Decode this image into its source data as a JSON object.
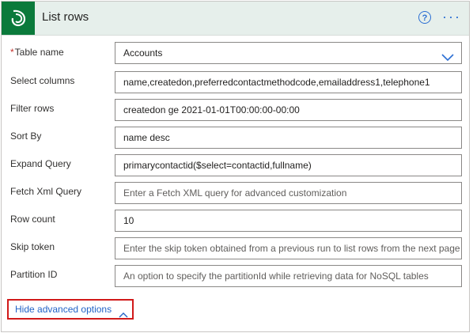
{
  "header": {
    "title": "List rows",
    "help_glyph": "?",
    "more_glyph": "···",
    "accent": "#2b6fd3",
    "logo_bg": "#0b7a3b"
  },
  "fields": [
    {
      "label": "Table name",
      "required": true,
      "value": "Accounts",
      "placeholder": "",
      "dropdown": true
    },
    {
      "label": "Select columns",
      "required": false,
      "value": "name,createdon,preferredcontactmethodcode,emailaddress1,telephone1",
      "placeholder": ""
    },
    {
      "label": "Filter rows",
      "required": false,
      "value": "createdon ge 2021-01-01T00:00:00-00:00",
      "placeholder": ""
    },
    {
      "label": "Sort By",
      "required": false,
      "value": "name desc",
      "placeholder": ""
    },
    {
      "label": "Expand Query",
      "required": false,
      "value": "primarycontactid($select=contactid,fullname)",
      "placeholder": ""
    },
    {
      "label": "Fetch Xml Query",
      "required": false,
      "value": "",
      "placeholder": "Enter a Fetch XML query for advanced customization"
    },
    {
      "label": "Row count",
      "required": false,
      "value": "10",
      "placeholder": ""
    },
    {
      "label": "Skip token",
      "required": false,
      "value": "",
      "placeholder": "Enter the skip token obtained from a previous run to list rows from the next page"
    },
    {
      "label": "Partition ID",
      "required": false,
      "value": "",
      "placeholder": "An option to specify the partitionId while retrieving data for NoSQL tables"
    }
  ],
  "required_mark": "*",
  "footer": {
    "toggle_label": "Hide advanced options",
    "highlight_color": "#d11a1a"
  }
}
